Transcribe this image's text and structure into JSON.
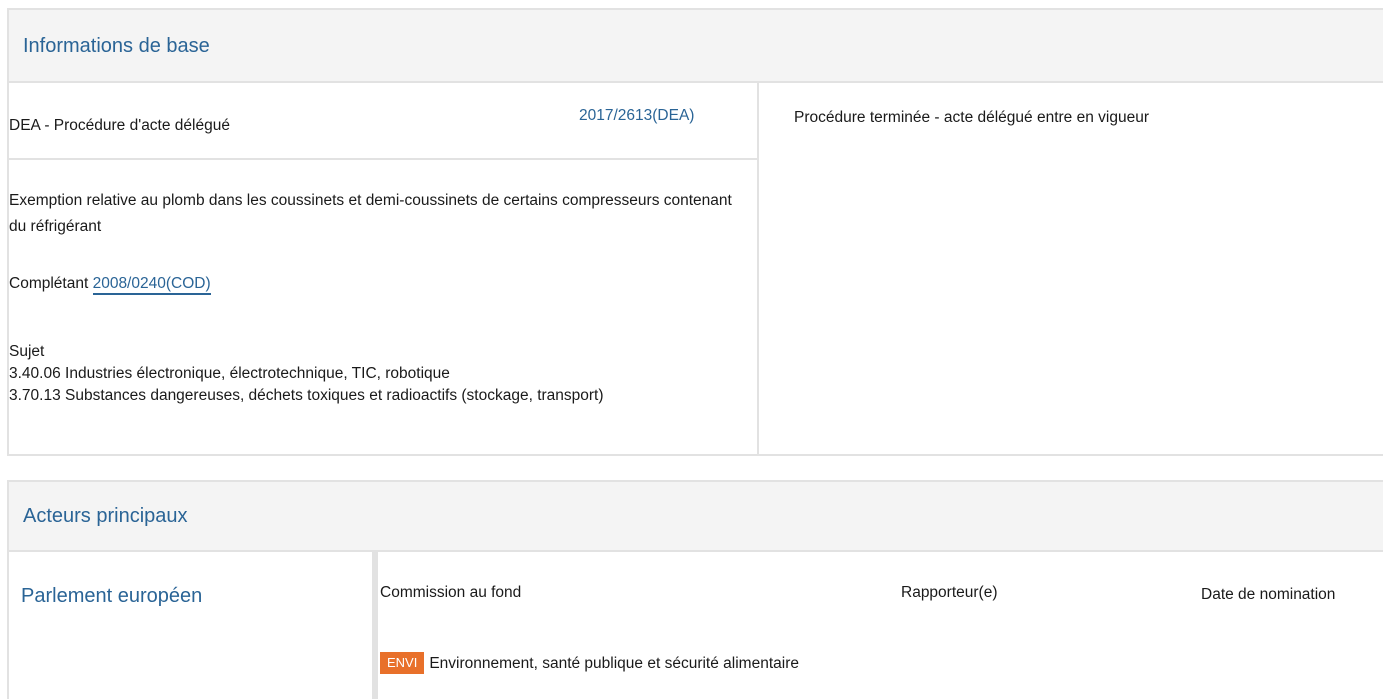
{
  "basic_info": {
    "header": "Informations de base",
    "procedure_type": "DEA - Procédure d'acte délégué",
    "reference": "2017/2613(DEA)",
    "description": "Exemption relative au plomb dans les coussinets et demi-coussinets de certains compresseurs contenant du réfrigérant",
    "completant_label": "Complétant",
    "completant_ref": "2008/0240(COD)",
    "subject_label": "Sujet",
    "subjects": [
      "3.40.06 Industries électronique, électrotechnique, TIC, robotique",
      "3.70.13 Substances dangereuses, déchets toxiques et radioactifs (stockage, transport)"
    ],
    "status": "Procédure terminée - acte délégué entre en vigueur"
  },
  "key_players": {
    "header": "Acteurs principaux",
    "institution": "Parlement européen",
    "columns": {
      "committee": "Commission au fond",
      "rapporteur": "Rapporteur(e)",
      "date": "Date de nomination"
    },
    "committee_badge": "ENVI",
    "committee_name": "Environnement, santé publique et sécurité alimentaire",
    "badge_color": "#e8702a"
  }
}
